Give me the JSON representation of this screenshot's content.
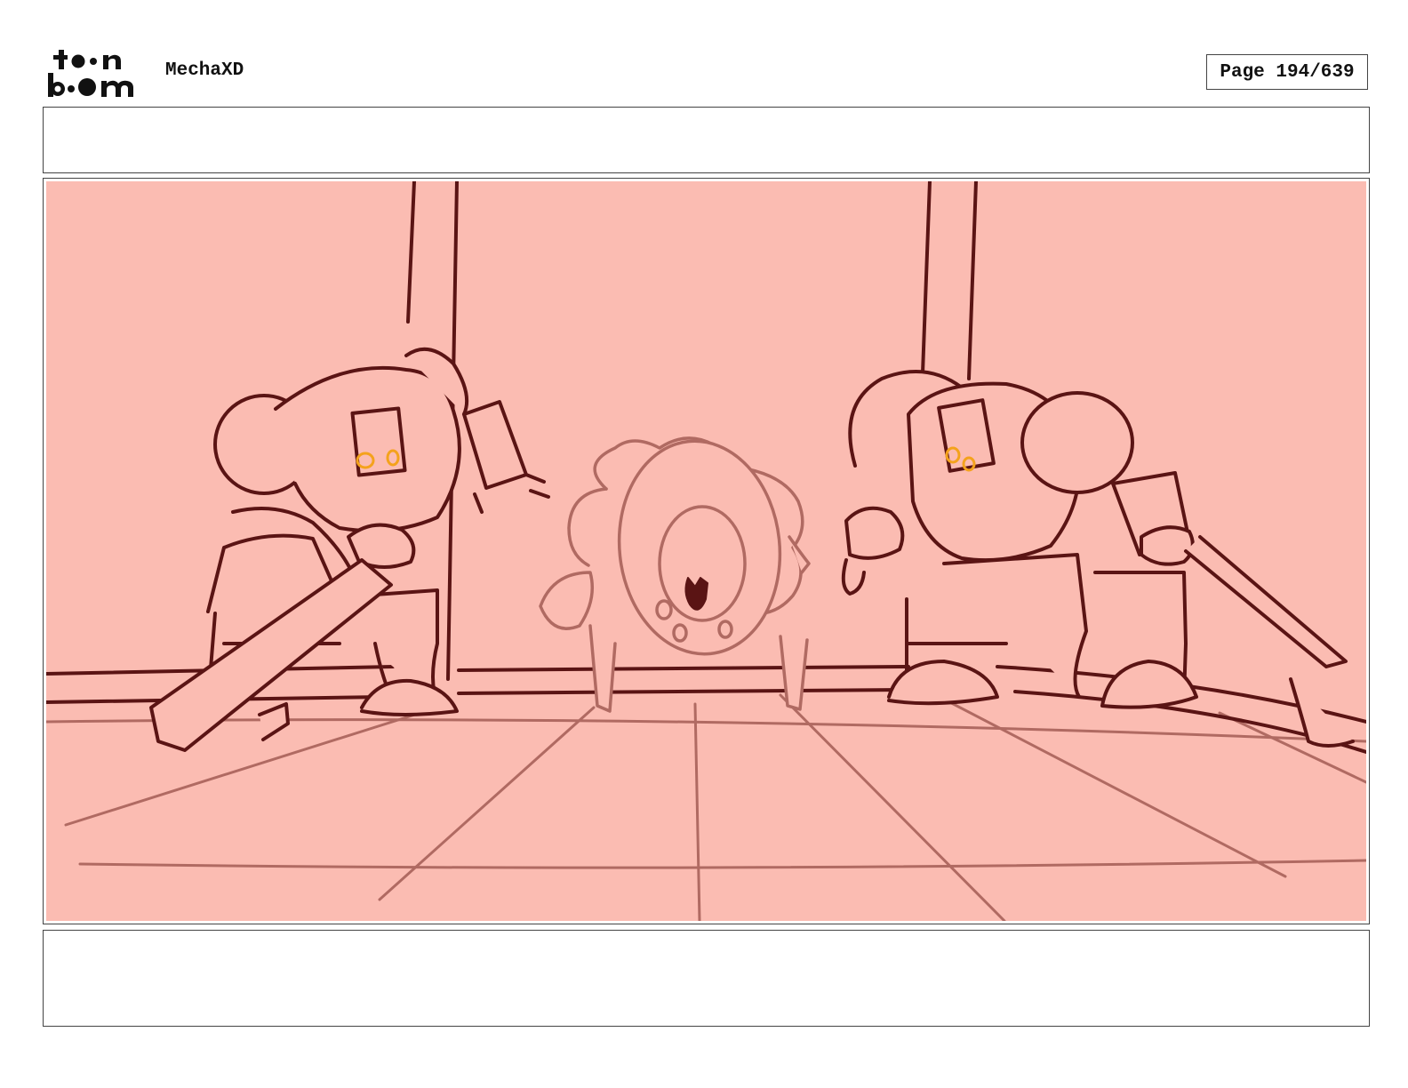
{
  "header": {
    "logo": {
      "line1": "toon",
      "line2": "boom"
    },
    "project_name": "MechaXD",
    "page_label": "Page 194/639"
  },
  "caption": "",
  "notes": "",
  "colors": {
    "panel_background": "#fbbcb2",
    "ink_dark": "#5a1414",
    "ink_light": "#b06a62",
    "eye_glow": "#f4a21c"
  }
}
